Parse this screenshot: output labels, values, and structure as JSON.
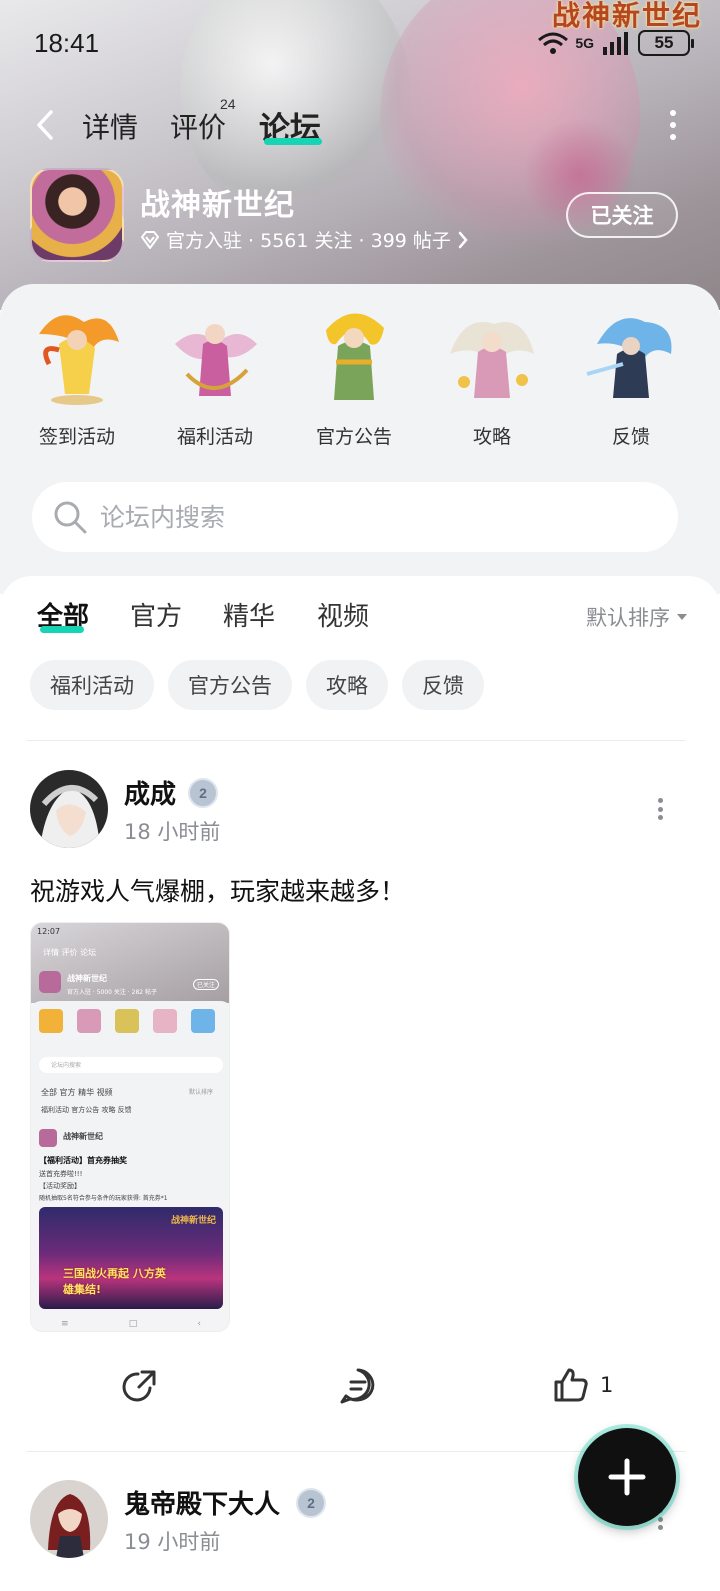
{
  "status_bar": {
    "time": "18:41",
    "network": "5G",
    "battery": "55"
  },
  "nav": {
    "tabs": [
      {
        "label": "详情"
      },
      {
        "label": "评价",
        "badge": "24"
      },
      {
        "label": "论坛",
        "active": true
      }
    ]
  },
  "banner_logo": "战神新世纪",
  "game": {
    "name": "战神新世纪",
    "meta": "官方入驻 · 5561 关注 · 399 帖子",
    "follow_label": "已关注"
  },
  "categories": [
    {
      "label": "签到活动",
      "icon": "phoenix-warrior-icon"
    },
    {
      "label": "福利活动",
      "icon": "dancer-hero-icon"
    },
    {
      "label": "官方公告",
      "icon": "golden-general-icon"
    },
    {
      "label": "攻略",
      "icon": "white-dragon-hero-icon"
    },
    {
      "label": "反馈",
      "icon": "blue-dragon-knight-icon"
    }
  ],
  "search": {
    "placeholder": "论坛内搜索"
  },
  "feed_tabs": [
    {
      "label": "全部",
      "active": true
    },
    {
      "label": "官方"
    },
    {
      "label": "精华"
    },
    {
      "label": "视频"
    }
  ],
  "sort_label": "默认排序",
  "chips": [
    "福利活动",
    "官方公告",
    "攻略",
    "反馈"
  ],
  "posts": [
    {
      "user": "成成",
      "level": "2",
      "time": "18 小时前",
      "text": "祝游戏人气爆棚，玩家越来越多！",
      "likes": "1",
      "screenshot": {
        "time": "12:07",
        "tabs": "详情  评价  论坛",
        "game_name": "战神新世纪",
        "game_meta": "官方入驻 · 5000 关注 · 282 帖子",
        "follow": "已关注",
        "search": "论坛内搜索",
        "feed_tabs": "全部  官方  精华  视频",
        "sort": "默认排序",
        "chips": "福利活动  官方公告  攻略  反馈",
        "post_user": "战神新世纪",
        "post_title": "【福利活动】首充券抽奖",
        "post_line1": "送首充券啦!!!",
        "post_line2": "【活动奖励】",
        "post_line3": "随机抽取5名符合参与条件的玩家获得: 首充券*1",
        "banner_text": "三国战火再起 八方英雄集结!",
        "banner_logo": "战神新世纪"
      }
    },
    {
      "user": "鬼帝殿下大人",
      "level": "2",
      "time": "19 小时前"
    }
  ]
}
